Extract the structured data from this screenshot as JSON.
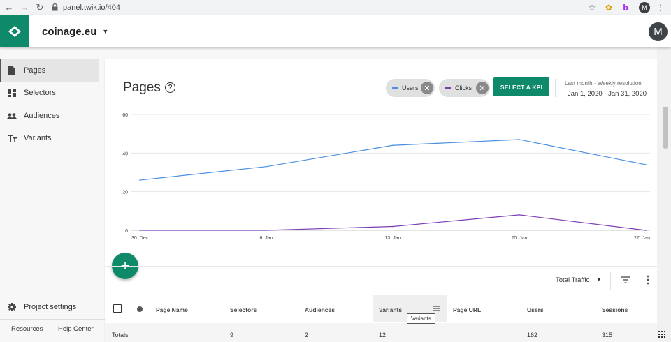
{
  "browser": {
    "url": "panel.twik.io/404",
    "profile_initial": "M",
    "ext_b_label": "b"
  },
  "header": {
    "site_name": "coinage.eu",
    "avatar_initial": "M"
  },
  "sidebar": {
    "items": [
      {
        "label": "Pages",
        "icon": "page-icon",
        "active": true
      },
      {
        "label": "Selectors",
        "icon": "selectors-icon",
        "active": false
      },
      {
        "label": "Audiences",
        "icon": "people-icon",
        "active": false
      },
      {
        "label": "Variants",
        "icon": "text-icon",
        "active": false
      }
    ],
    "project_settings": "Project settings",
    "resources": "Resources",
    "help_center": "Help Center"
  },
  "main": {
    "title": "Pages",
    "chips": [
      {
        "label": "Users",
        "color": "#4a8fe0"
      },
      {
        "label": "Clicks",
        "color": "#7b3fb5"
      }
    ],
    "kpi_button": "SELECT A KPI",
    "range_label": "Last month · Weekly resolution",
    "range_value": "Jan 1, 2020 - Jan 31, 2020",
    "traffic_select": "Total Traffic",
    "add_button": "+",
    "table": {
      "headers": [
        "Page Name",
        "Selectors",
        "Audiences",
        "Variants",
        "Page URL",
        "Users",
        "Sessions"
      ],
      "tooltip": "Variants",
      "totals": {
        "label": "Totals",
        "selectors": "9",
        "audiences": "2",
        "variants": "12",
        "users": "162",
        "sessions": "315"
      }
    }
  },
  "chart_data": {
    "type": "line",
    "x": [
      "30. Dec",
      "6. Jan",
      "13. Jan",
      "20. Jan",
      "27. Jan"
    ],
    "yticks": [
      0,
      20,
      40,
      60
    ],
    "ylim": [
      0,
      60
    ],
    "grid": true,
    "series": [
      {
        "name": "Users",
        "color": "#4a8fe0",
        "values": [
          26,
          33,
          44,
          47,
          34
        ]
      },
      {
        "name": "Clicks",
        "color": "#7b3fb5",
        "values": [
          0,
          0,
          2,
          8,
          0
        ]
      }
    ]
  }
}
